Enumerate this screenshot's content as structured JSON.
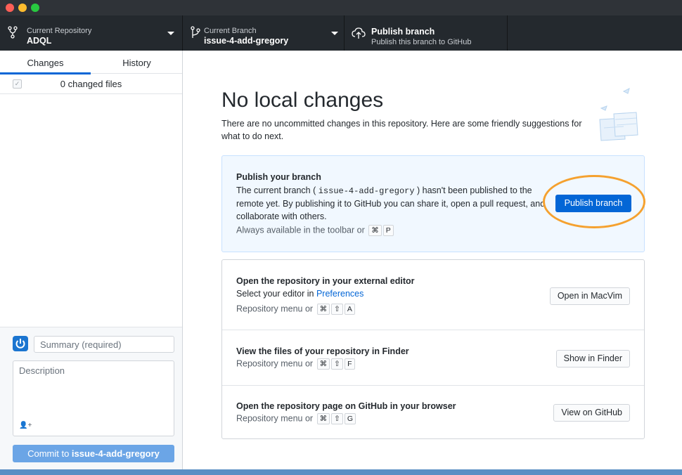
{
  "toolbar": {
    "repository": {
      "label": "Current Repository",
      "name": "ADQL",
      "icon": "repo-icon"
    },
    "branch": {
      "label": "Current Branch",
      "name": "issue-4-add-gregory",
      "icon": "git-branch-icon"
    },
    "publish": {
      "title": "Publish branch",
      "description": "Publish this branch to GitHub",
      "icon": "cloud-upload-icon"
    }
  },
  "sidebar": {
    "tabs": [
      {
        "label": "Changes",
        "selected": true
      },
      {
        "label": "History",
        "selected": false
      }
    ],
    "changed_files": "0 changed files",
    "commit": {
      "summary_placeholder": "Summary (required)",
      "description_placeholder": "Description",
      "button_prefix": "Commit to ",
      "button_branch": "issue-4-add-gregory"
    }
  },
  "main": {
    "title": "No local changes",
    "description": "There are no uncommitted changes in this repository. Here are some friendly suggestions for what to do next.",
    "publish_callout": {
      "title": "Publish your branch",
      "text_before": "The current branch ( ",
      "branch_code": "issue-4-add-gregory",
      "text_after": " ) hasn't been published to the remote yet. By publishing it to GitHub you can share it, open a pull request, and collaborate with others.",
      "shortcut_text": "Always available in the toolbar or",
      "shortcut_keys": [
        "⌘",
        "P"
      ],
      "button": "Publish branch"
    },
    "actions": [
      {
        "title": "Open the repository in your external editor",
        "subtitle_prefix": "Select your editor in ",
        "subtitle_link": "Preferences",
        "hint": "Repository menu or",
        "keys": [
          "⌘",
          "⇧",
          "A"
        ],
        "button": "Open in MacVim"
      },
      {
        "title": "View the files of your repository in Finder",
        "hint": "Repository menu or",
        "keys": [
          "⌘",
          "⇧",
          "F"
        ],
        "button": "Show in Finder"
      },
      {
        "title": "Open the repository page on GitHub in your browser",
        "hint": "Repository menu or",
        "keys": [
          "⌘",
          "⇧",
          "G"
        ],
        "button": "View on GitHub"
      }
    ]
  },
  "colors": {
    "toolbar_bg": "#24292e",
    "accent": "#0366d6",
    "callout_bg": "#f1f8ff",
    "highlight_ring": "#f5a12f"
  }
}
